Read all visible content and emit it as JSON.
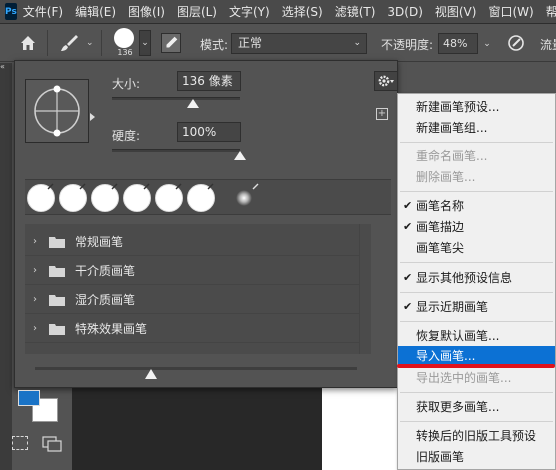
{
  "menubar": {
    "logo": "Ps",
    "items": [
      "文件(F)",
      "编辑(E)",
      "图像(I)",
      "图层(L)",
      "文字(Y)",
      "选择(S)",
      "滤镜(T)",
      "3D(D)",
      "视图(V)",
      "窗口(W)",
      "帮"
    ]
  },
  "options": {
    "brush_size": "136",
    "mode_label": "模式:",
    "mode_value": "正常",
    "opacity_label": "不透明度:",
    "opacity_value": "48%",
    "flow_label": "流量"
  },
  "brush_panel": {
    "size_label": "大小:",
    "size_value": "136 像素",
    "size_slider_fraction": 0.63,
    "hardness_label": "硬度:",
    "hardness_value": "100%",
    "hardness_slider_fraction": 1.0,
    "folders": [
      "常规画笔",
      "干介质画笔",
      "湿介质画笔",
      "特殊效果画笔"
    ]
  },
  "context_menu": {
    "items": [
      {
        "label": "新建画笔预设...",
        "state": "normal",
        "checked": false
      },
      {
        "label": "新建画笔组...",
        "state": "normal",
        "checked": false
      },
      {
        "label": "重命名画笔...",
        "state": "disabled",
        "checked": false
      },
      {
        "label": "删除画笔...",
        "state": "disabled",
        "checked": false
      },
      {
        "label": "画笔名称",
        "state": "normal",
        "checked": true
      },
      {
        "label": "画笔描边",
        "state": "normal",
        "checked": true
      },
      {
        "label": "画笔笔尖",
        "state": "normal",
        "checked": false
      },
      {
        "label": "显示其他预设信息",
        "state": "normal",
        "checked": true
      },
      {
        "label": "显示近期画笔",
        "state": "normal",
        "checked": true
      },
      {
        "label": "恢复默认画笔...",
        "state": "normal",
        "checked": false
      },
      {
        "label": "导入画笔...",
        "state": "highlight",
        "checked": false
      },
      {
        "label": "导出选中的画笔...",
        "state": "disabled",
        "checked": false
      },
      {
        "label": "获取更多画笔...",
        "state": "normal",
        "checked": false
      },
      {
        "label": "转换后的旧版工具预设",
        "state": "normal",
        "checked": false
      },
      {
        "label": "旧版画笔",
        "state": "normal",
        "checked": false
      }
    ],
    "check_glyph": "✔"
  },
  "colors": {
    "foreground": "#1a73c6",
    "background": "#ffffff",
    "highlight": "#0c71d4",
    "annotation": "#e0121c"
  }
}
